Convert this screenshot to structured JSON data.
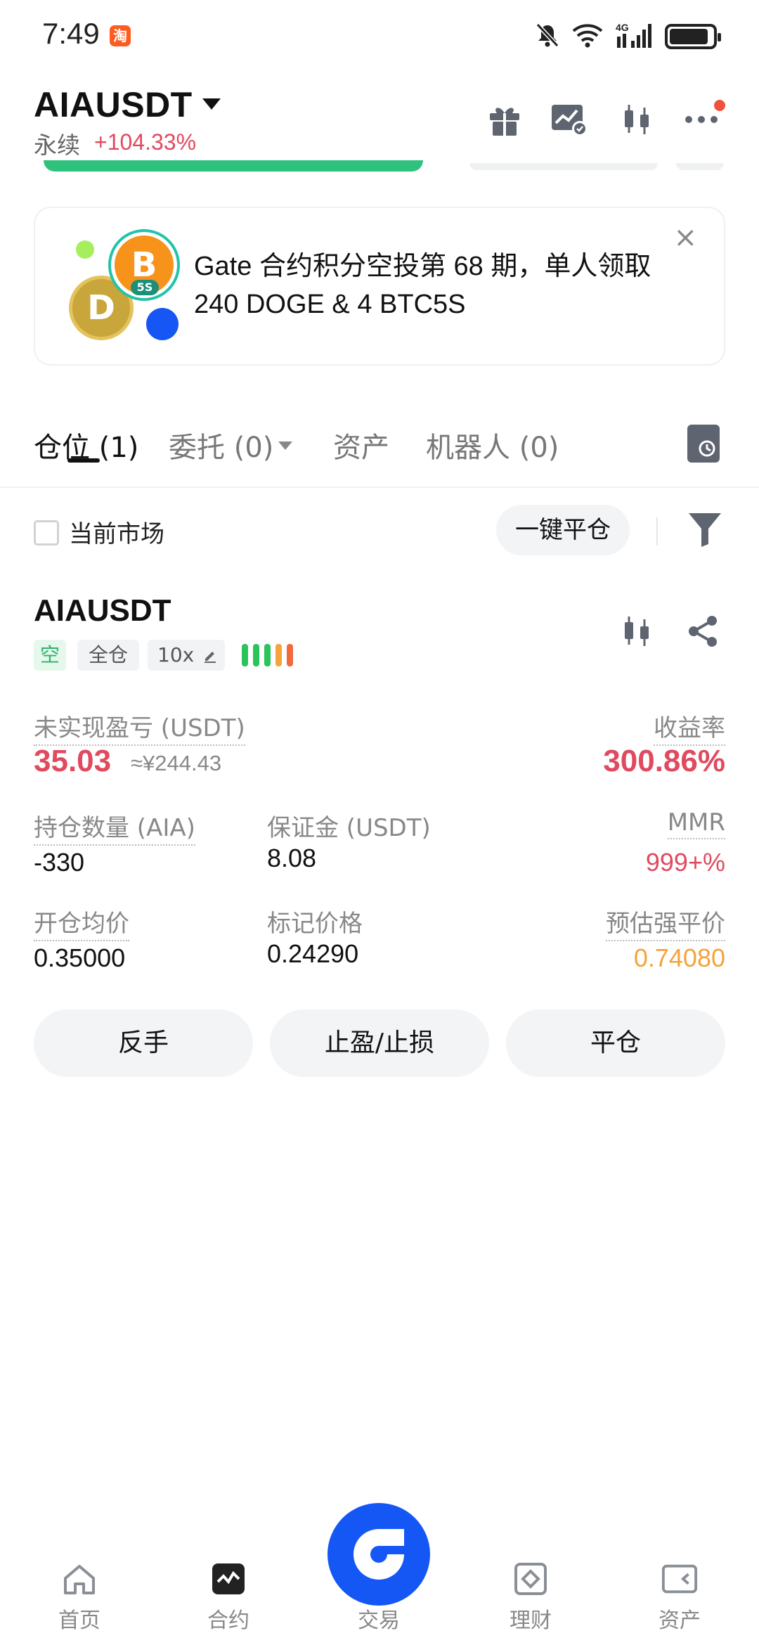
{
  "status_bar": {
    "time": "7:49",
    "app_badge": "淘",
    "network": "4G"
  },
  "header": {
    "pair": "AIAUSDT",
    "contract_type": "永续",
    "change": "+104.33%"
  },
  "banner": {
    "text": "Gate 合约积分空投第 68 期，单人领取 240 DOGE & 4 BTC5S",
    "close": "×",
    "coin_btc": "B",
    "coin_btc_tag": "5S",
    "coin_doge": "D"
  },
  "tabs": [
    {
      "label": "仓位",
      "count": "(1)"
    },
    {
      "label": "委托",
      "count": "(0)"
    },
    {
      "label": "资产",
      "count": ""
    },
    {
      "label": "机器人",
      "count": "(0)"
    }
  ],
  "filter": {
    "current_market": "当前市场",
    "close_all": "一键平仓"
  },
  "position": {
    "symbol": "AIAUSDT",
    "side": "空",
    "margin_mode": "全仓",
    "leverage": "10x",
    "leverage_bar_colors": [
      "#2cc45a",
      "#2cc45a",
      "#2cc45a",
      "#f5a33b",
      "#f26a3c"
    ],
    "unrealized_pnl_label": "未实现盈亏 (USDT)",
    "unrealized_pnl": "35.03",
    "unrealized_pnl_cny": "≈¥244.43",
    "roe_label": "收益率",
    "roe": "300.86%",
    "size_label": "持仓数量 (AIA)",
    "size": "-330",
    "margin_label": "保证金 (USDT)",
    "margin": "8.08",
    "mmr_label": "MMR",
    "mmr": "999+%",
    "entry_label": "开仓均价",
    "entry": "0.35000",
    "mark_label": "标记价格",
    "mark": "0.24290",
    "liq_label": "预估强平价",
    "liq": "0.74080"
  },
  "actions": {
    "reverse": "反手",
    "tpsl": "止盈/止损",
    "close": "平仓"
  },
  "nav": [
    {
      "label": "首页",
      "icon": "home-icon"
    },
    {
      "label": "合约",
      "icon": "futures-icon"
    },
    {
      "label": "交易",
      "icon": "trade-icon"
    },
    {
      "label": "理财",
      "icon": "earn-icon"
    },
    {
      "label": "资产",
      "icon": "wallet-icon"
    }
  ],
  "colors": {
    "red": "#e04a5f",
    "green": "#2cb36b",
    "orange": "#f5a33b",
    "brand_blue": "#1457f5"
  }
}
